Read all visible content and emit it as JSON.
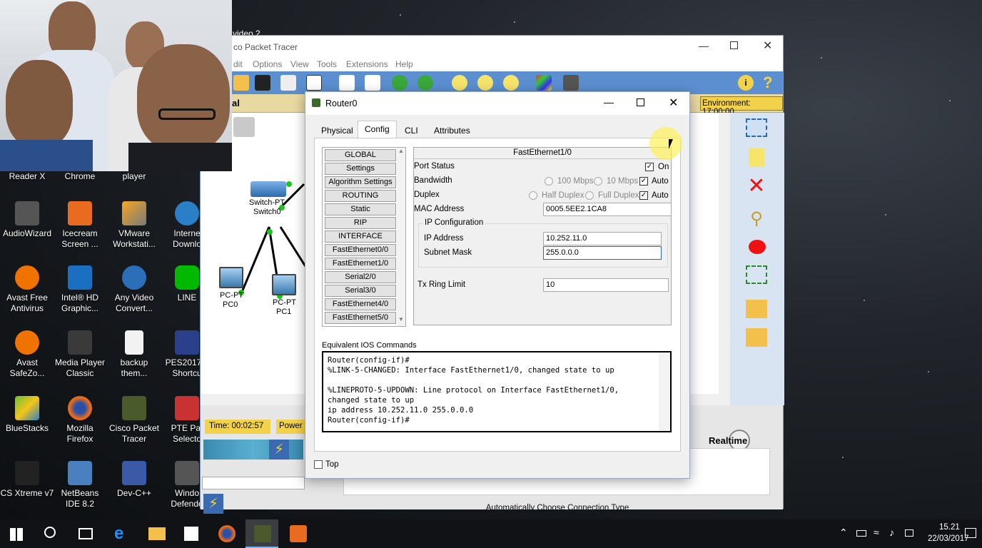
{
  "webcam_overlay": {
    "partial_label": "video 2"
  },
  "desktop": {
    "icons": [
      {
        "label": "Reader X",
        "color": "#b8252a"
      },
      {
        "label": "Chrome",
        "color": "#2f8d3c"
      },
      {
        "label": "player",
        "color": "#444444"
      },
      {
        "label": "AudioWizard",
        "color": "#555555"
      },
      {
        "label": "Icecream Screen ...",
        "color": "#e86b1f"
      },
      {
        "label": "VMware Workstati...",
        "color": "#4a4a4a"
      },
      {
        "label": "Interne Downlo",
        "color": "#2a7fc7"
      },
      {
        "label": "Avast Free Antivirus",
        "color": "#f07300"
      },
      {
        "label": "Intel® HD Graphic...",
        "color": "#1a6fc0"
      },
      {
        "label": "Any Video Convert...",
        "color": "#2b6fb8"
      },
      {
        "label": "LINE",
        "color": "#00b900"
      },
      {
        "label": "Avast SafeZo...",
        "color": "#f07300"
      },
      {
        "label": "Media Player Classic",
        "color": "#3a3a3a"
      },
      {
        "label": "backup them...",
        "color": "#e8e8e8"
      },
      {
        "label": "PES2017.e Shortcu",
        "color": "#2b3f8a"
      },
      {
        "label": "BlueStacks",
        "color": "#6cbf3a"
      },
      {
        "label": "Mozilla Firefox",
        "color": "#e66a1a"
      },
      {
        "label": "Cisco Packet Tracer",
        "color": "#4a5a2a"
      },
      {
        "label": "PTE Pat Selecto",
        "color": "#c83232"
      },
      {
        "label": "CS Xtreme v7",
        "color": "#222222"
      },
      {
        "label": "NetBeans IDE 8.2",
        "color": "#4a80c0"
      },
      {
        "label": "Dev-C++",
        "color": "#3a5aa8"
      },
      {
        "label": "Windo Defende",
        "color": "#555555"
      }
    ]
  },
  "cpt": {
    "title": "co Packet Tracer",
    "menu": [
      "dit",
      "Options",
      "View",
      "Tools",
      "Extensions",
      "Help"
    ],
    "workspace_label": "al",
    "environment": "Environment: 17:00:00",
    "devices": {
      "switch": {
        "type": "Switch-PT",
        "name": "Switch0"
      },
      "pc0": {
        "type": "PC-PT",
        "name": "PC0"
      },
      "pc1": {
        "type": "PC-PT",
        "name": "PC1"
      }
    },
    "time": "Time: 00:02:57",
    "power": "Power",
    "realtime": "Realtime",
    "connection_type": "Automatically Choose Connection Type"
  },
  "dialog": {
    "title": "Router0",
    "tabs": [
      "Physical",
      "Config",
      "CLI",
      "Attributes"
    ],
    "active_tab": "Config",
    "left_buttons": [
      "GLOBAL",
      "Settings",
      "Algorithm Settings",
      "ROUTING",
      "Static",
      "RIP",
      "INTERFACE",
      "FastEthernet0/0",
      "FastEthernet1/0",
      "Serial2/0",
      "Serial3/0",
      "FastEthernet4/0",
      "FastEthernet5/0"
    ],
    "interface": {
      "header": "FastEthernet1/0",
      "port_status_label": "Port Status",
      "port_status_on": "On",
      "bandwidth_label": "Bandwidth",
      "bw_100": "100 Mbps",
      "bw_10": "10 Mbps",
      "auto": "Auto",
      "duplex_label": "Duplex",
      "half": "Half Duplex",
      "full": "Full Duplex",
      "mac_label": "MAC Address",
      "mac_value": "0005.5EE2.1CA8",
      "ip_config_label": "IP Configuration",
      "ip_label": "IP Address",
      "ip_value": "10.252.11.0",
      "mask_label": "Subnet Mask",
      "mask_value": "255.0.0.0",
      "tx_label": "Tx Ring Limit",
      "tx_value": "10"
    },
    "ios_label": "Equivalent IOS Commands",
    "ios_lines": [
      "Router(config-if)#",
      "%LINK-5-CHANGED: Interface FastEthernet1/0, changed state to up",
      "",
      "%LINEPROTO-5-UPDOWN: Line protocol on Interface FastEthernet1/0,",
      "changed state to up",
      "ip address 10.252.11.0 255.0.0.0",
      "Router(config-if)#"
    ],
    "top_label": "Top"
  },
  "taskbar": {
    "time": "15.21",
    "date": "22/03/2017"
  }
}
